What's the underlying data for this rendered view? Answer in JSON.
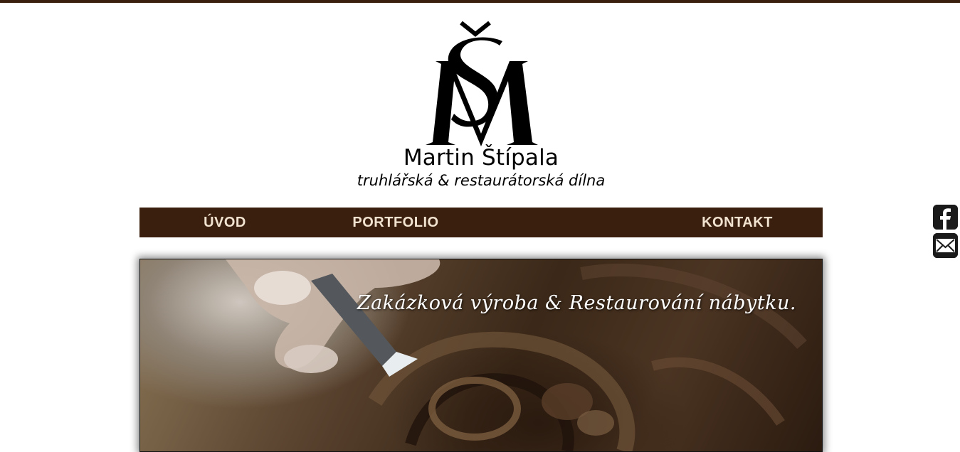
{
  "logo": {
    "monogram": "ŠM",
    "name": "Martin Štípala",
    "tagline": "truhlářská & restaurátorská dílna"
  },
  "nav": {
    "items": [
      {
        "label": "ÚVOD"
      },
      {
        "label": "PORTFOLIO"
      },
      {
        "label": "KONTAKT"
      }
    ]
  },
  "hero": {
    "caption": "Zakázková výroba & Restaurování nábytku."
  },
  "social": {
    "facebook_icon": "facebook-icon",
    "email_icon": "envelope-icon"
  },
  "colors": {
    "brand_dark_brown": "#3a1e0e",
    "nav_text": "#f1e3cf"
  }
}
